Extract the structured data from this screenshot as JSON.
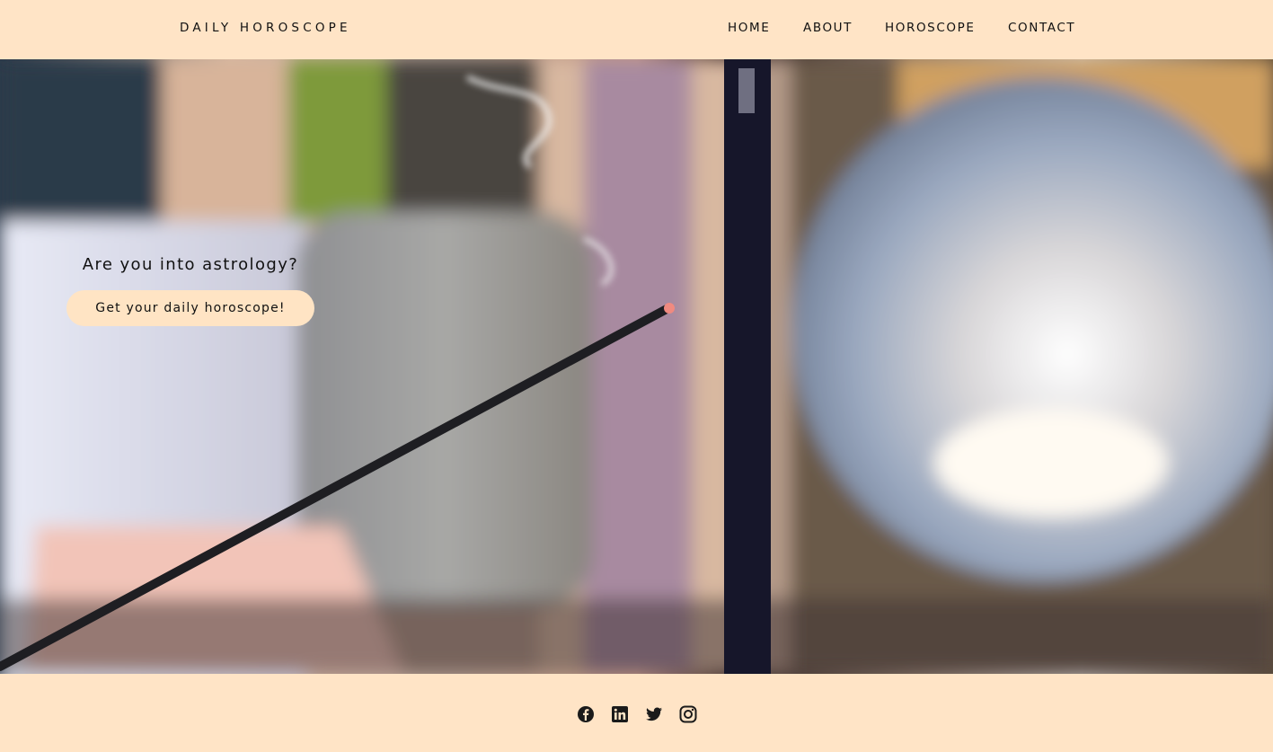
{
  "header": {
    "brand": "DAILY HOROSCOPE",
    "nav": [
      "HOME",
      "ABOUT",
      "HOROSCOPE",
      "CONTACT"
    ]
  },
  "hero": {
    "title": "Are you into astrology?",
    "cta_label": "Get your daily horoscope!",
    "image_description_icon": "incense-crystal-ball-photo"
  },
  "footer": {
    "socials": [
      "facebook-icon",
      "linkedin-icon",
      "twitter-icon",
      "instagram-icon"
    ]
  },
  "colors": {
    "accent": "#ffe4c4",
    "text": "#111111"
  }
}
